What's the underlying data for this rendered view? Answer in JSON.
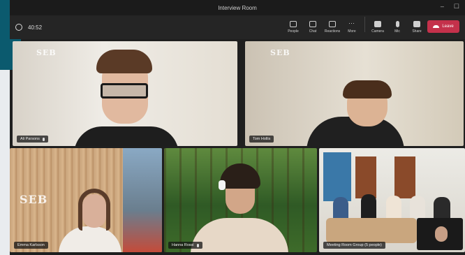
{
  "window": {
    "title": "Interview Room",
    "minimize": "–",
    "maximize": "☐"
  },
  "meeting": {
    "timer": "40:52"
  },
  "toolbar": {
    "tools": [
      "People",
      "Chat",
      "Reactions",
      "More",
      "Camera",
      "Mic",
      "Share"
    ],
    "leave_label": "Leave"
  },
  "participants": [
    {
      "name": "Ali Parsons",
      "logo": "SEB"
    },
    {
      "name": "Tom Hollis",
      "logo": "SEB"
    },
    {
      "name": "Emma Karlsson",
      "logo": "SEB"
    },
    {
      "name": "Hanna Rossi"
    },
    {
      "name": "Meeting Room Group (5 people)"
    }
  ],
  "colors": {
    "leave": "#c4314b",
    "toolbar": "#252525",
    "accent_bg": "#0b5a6e"
  }
}
